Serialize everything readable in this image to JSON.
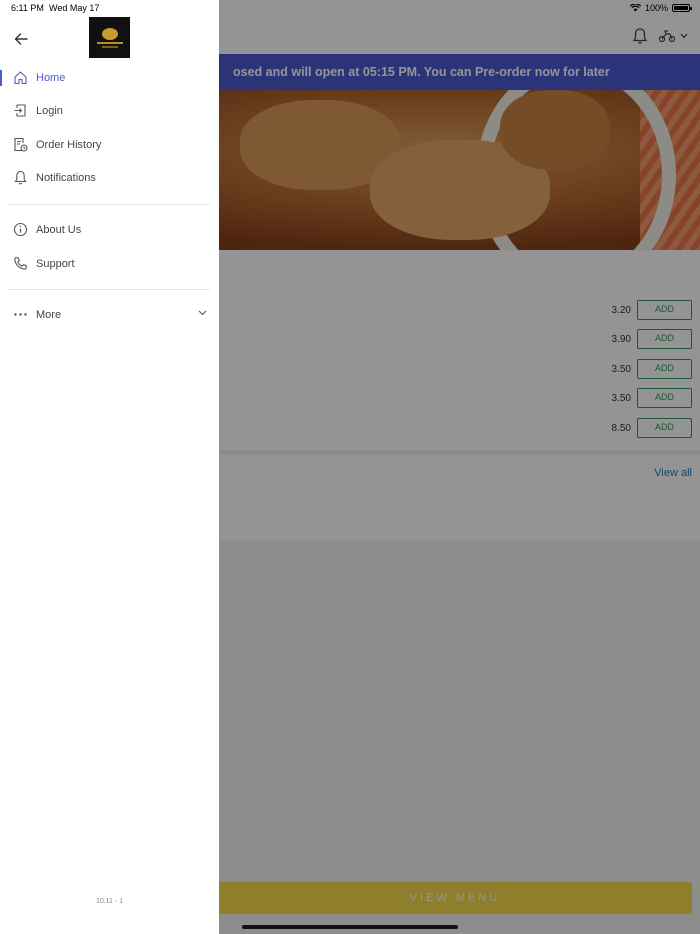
{
  "status_bar": {
    "time": "6:11 PM",
    "date": "Wed May 17",
    "battery": "100%"
  },
  "banner": {
    "text": "osed and will open at 05:15 PM. You can Pre-order now for later"
  },
  "menu_items": [
    {
      "price": "3.20",
      "add_label": "ADD"
    },
    {
      "price": "3.90",
      "add_label": "ADD"
    },
    {
      "price": "3.50",
      "add_label": "ADD"
    },
    {
      "price": "3.50",
      "add_label": "ADD"
    },
    {
      "price": "8.50",
      "add_label": "ADD"
    }
  ],
  "view_all": "View all",
  "view_menu": "VIEW MENU",
  "drawer": {
    "nav_top": [
      {
        "label": "Home",
        "icon": "home-icon",
        "active": true
      },
      {
        "label": "Login",
        "icon": "login-icon",
        "active": false
      },
      {
        "label": "Order History",
        "icon": "order-history-icon",
        "active": false
      },
      {
        "label": "Notifications",
        "icon": "bell-icon",
        "active": false
      }
    ],
    "nav_bottom": [
      {
        "label": "About Us",
        "icon": "info-icon"
      },
      {
        "label": "Support",
        "icon": "phone-icon"
      }
    ],
    "more_label": "More",
    "version": "10.11 - 1"
  },
  "colors": {
    "accent": "#4d5bd1",
    "add_green": "#2e9a5c",
    "view_menu_yellow": "#f6d94b",
    "link_blue": "#1f7fb8"
  }
}
